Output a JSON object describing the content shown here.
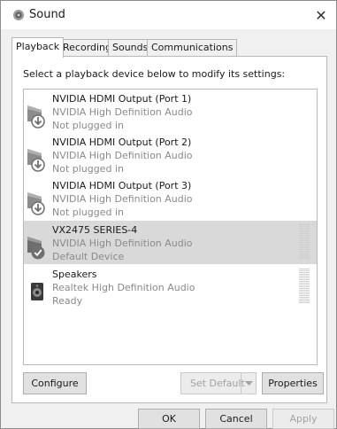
{
  "window": {
    "title": "Sound",
    "close_glyph": "✕"
  },
  "tabs": [
    {
      "label": "Playback"
    },
    {
      "label": "Recording"
    },
    {
      "label": "Sounds"
    },
    {
      "label": "Communications"
    }
  ],
  "instruction": "Select a playback device below to modify its settings:",
  "devices": [
    {
      "name": "NVIDIA HDMI Output (Port 1)",
      "driver": "NVIDIA High Definition Audio",
      "status": "Not plugged in",
      "icon": "monitor-unplugged-icon"
    },
    {
      "name": "NVIDIA HDMI Output (Port 2)",
      "driver": "NVIDIA High Definition Audio",
      "status": "Not plugged in",
      "icon": "monitor-unplugged-icon"
    },
    {
      "name": "NVIDIA HDMI Output (Port 3)",
      "driver": "NVIDIA High Definition Audio",
      "status": "Not plugged in",
      "icon": "monitor-unplugged-icon"
    },
    {
      "name": "VX2475 SERIES-4",
      "driver": "NVIDIA High Definition Audio",
      "status": "Default Device",
      "icon": "monitor-default-icon",
      "selected": true
    },
    {
      "name": "Speakers",
      "driver": "Realtek High Definition Audio",
      "status": "Ready",
      "icon": "speaker-icon"
    }
  ],
  "buttons": {
    "configure": "Configure",
    "set_default": "Set Default",
    "properties": "Properties",
    "ok": "OK",
    "cancel": "Cancel",
    "apply": "Apply"
  },
  "colors": {
    "selected_row": "#d9d9d9",
    "disabled_text": "#a3a3a3",
    "default_check": "#6f6f6f"
  }
}
